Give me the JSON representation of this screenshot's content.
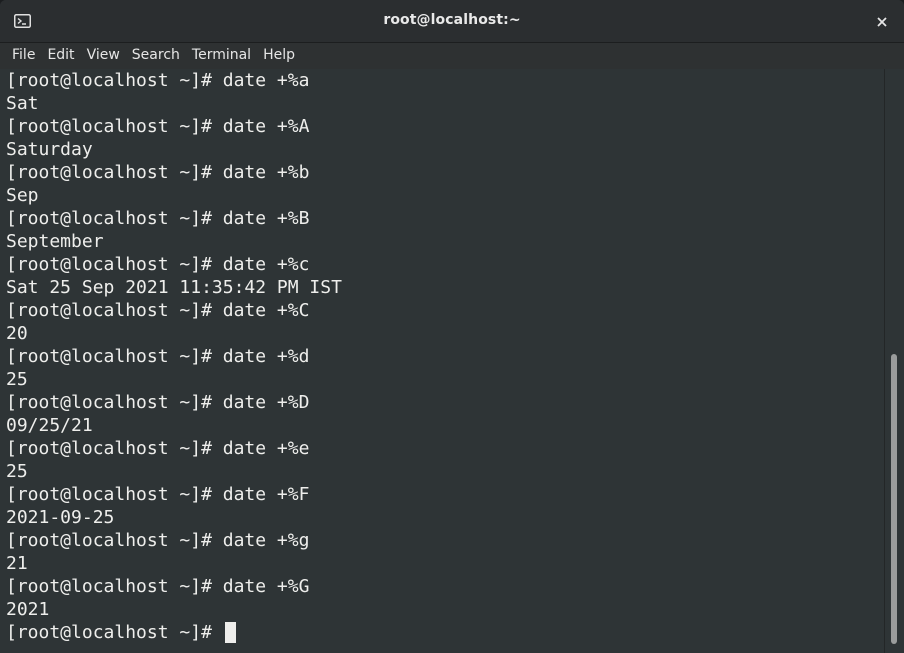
{
  "window": {
    "title": "root@localhost:~",
    "icon": "terminal-icon",
    "close_icon": "close-icon"
  },
  "menu": {
    "items": [
      "File",
      "Edit",
      "View",
      "Search",
      "Terminal",
      "Help"
    ]
  },
  "terminal": {
    "lines": [
      "[root@localhost ~]# date +%a",
      "Sat",
      "[root@localhost ~]# date +%A",
      "Saturday",
      "[root@localhost ~]# date +%b",
      "Sep",
      "[root@localhost ~]# date +%B",
      "September",
      "[root@localhost ~]# date +%c",
      "Sat 25 Sep 2021 11:35:42 PM IST",
      "[root@localhost ~]# date +%C",
      "20",
      "[root@localhost ~]# date +%d",
      "25",
      "[root@localhost ~]# date +%D",
      "09/25/21",
      "[root@localhost ~]# date +%e",
      "25",
      "[root@localhost ~]# date +%F",
      "2021-09-25",
      "[root@localhost ~]# date +%g",
      "21",
      "[root@localhost ~]# date +%G",
      "2021"
    ],
    "prompt": "[root@localhost ~]# "
  },
  "colors": {
    "background": "#2e3436",
    "foreground": "#eeeeec",
    "titlebar": "#2b2e30"
  }
}
